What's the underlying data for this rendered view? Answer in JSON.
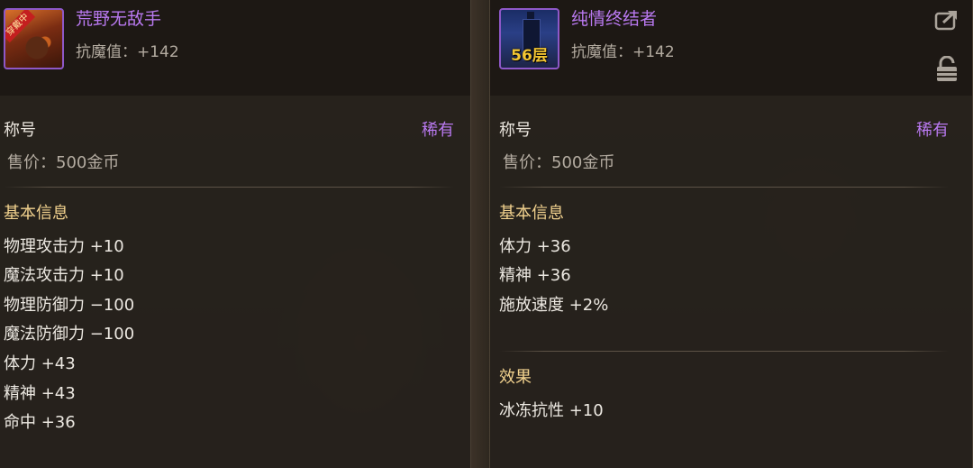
{
  "left": {
    "icon_badge": "穿戴中",
    "name": "荒野无敌手",
    "resist": "抗魔值：+142",
    "category": "称号",
    "rarity": "稀有",
    "price": "售价：500金币",
    "basic_title": "基本信息",
    "stats": [
      "物理攻击力 +10",
      "魔法攻击力 +10",
      "物理防御力 −100",
      "魔法防御力 −100",
      "体力 +43",
      "精神 +43",
      "命中 +36"
    ]
  },
  "right": {
    "icon_floor": "56层",
    "name": "纯情终结者",
    "resist": "抗魔值：+142",
    "category": "称号",
    "rarity": "稀有",
    "price": "售价：500金币",
    "basic_title": "基本信息",
    "stats": [
      "体力 +36",
      "精神 +36",
      "施放速度 +2%"
    ],
    "effect_title": "效果",
    "effects": [
      "冰冻抗性 +10"
    ]
  },
  "colors": {
    "rarity_purple": "#b979f0",
    "section_gold": "#f2d28e",
    "floor_yellow": "#f3c532"
  },
  "icons": [
    "share-icon",
    "lock-icon"
  ]
}
